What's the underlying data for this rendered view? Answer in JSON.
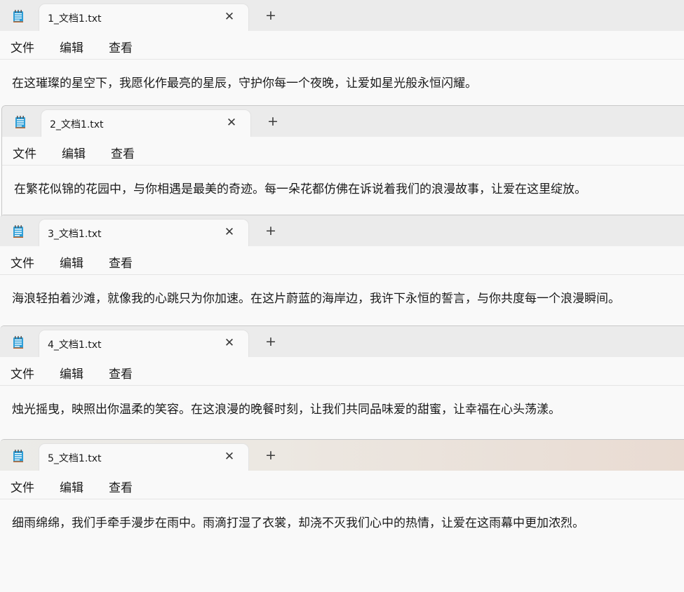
{
  "menu": {
    "file": "文件",
    "edit": "编辑",
    "view": "查看"
  },
  "new_tab_symbol": "+",
  "close_symbol": "✕",
  "windows": [
    {
      "tab_title": "1_文档1.txt",
      "content": "在这璀璨的星空下，我愿化作最亮的星辰，守护你每一个夜晚，让爱如星光般永恒闪耀。"
    },
    {
      "tab_title": "2_文档1.txt",
      "content": "在繁花似锦的花园中，与你相遇是最美的奇迹。每一朵花都仿佛在诉说着我们的浪漫故事，让爱在这里绽放。"
    },
    {
      "tab_title": "3_文档1.txt",
      "content": "海浪轻拍着沙滩，就像我的心跳只为你加速。在这片蔚蓝的海岸边，我许下永恒的誓言，与你共度每一个浪漫瞬间。"
    },
    {
      "tab_title": "4_文档1.txt",
      "content": "烛光摇曳，映照出你温柔的笑容。在这浪漫的晚餐时刻，让我们共同品味爱的甜蜜，让幸福在心头荡漾。"
    },
    {
      "tab_title": "5_文档1.txt",
      "content": "细雨绵绵，我们手牵手漫步在雨中。雨滴打湿了衣裳，却浇不灭我们心中的热情，让爱在这雨幕中更加浓烈。"
    }
  ]
}
